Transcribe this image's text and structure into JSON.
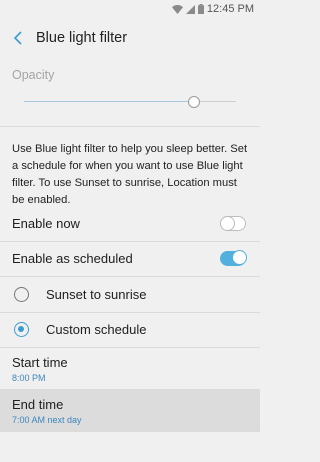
{
  "status_bar": {
    "time": "12:45 PM",
    "icons": [
      "wifi-icon",
      "signal-icon",
      "battery-icon"
    ]
  },
  "header": {
    "title": "Blue light filter",
    "back_icon": "back-arrow-icon"
  },
  "opacity": {
    "label": "Opacity",
    "slider_level": 0.83
  },
  "description": "Use Blue light filter to help you sleep better. Set a schedule for when you want to use Blue light filter. To use Sunset to sunrise, Location must be enabled.",
  "settings": {
    "enable_now": {
      "label": "Enable now",
      "state": "off"
    },
    "enable_scheduled": {
      "label": "Enable as scheduled",
      "state": "on"
    }
  },
  "schedule_options": [
    {
      "label": "Sunset to sunrise",
      "selected": false
    },
    {
      "label": "Custom schedule",
      "selected": true
    }
  ],
  "start_time": {
    "title": "Start time",
    "value": "8:00 PM"
  },
  "end_time": {
    "title": "End time",
    "value": "7:00 AM next day"
  },
  "colors": {
    "accent": "#3c9bd2",
    "toggle_on": "#52b0de",
    "background": "#f0f0f0",
    "highlight": "#dcdcdc"
  }
}
